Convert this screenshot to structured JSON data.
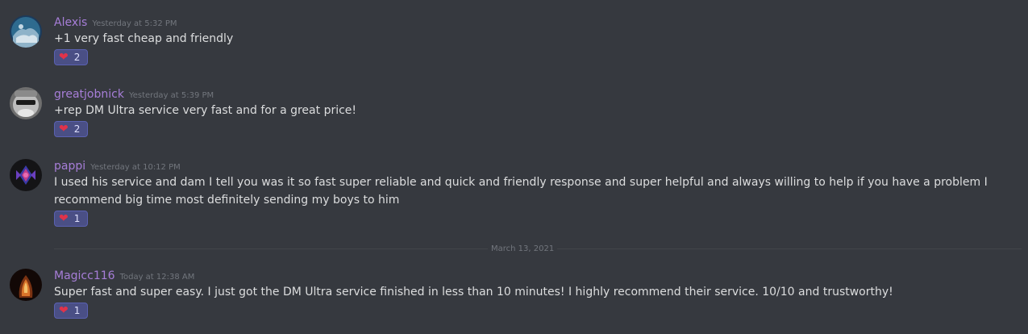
{
  "messages": [
    {
      "username": "Alexis",
      "timestamp": "Yesterday at 5:32 PM",
      "content": "+1 very fast cheap and friendly",
      "reaction": {
        "emoji": "heart-icon",
        "count": "2"
      }
    },
    {
      "username": "greatjobnick",
      "timestamp": "Yesterday at 5:39 PM",
      "content": "+rep DM Ultra service very fast and for a great price!",
      "reaction": {
        "emoji": "heart-icon",
        "count": "2"
      }
    },
    {
      "username": "pappi",
      "timestamp": "Yesterday at 10:12 PM",
      "content": "I used his service and dam I tell you was it so fast super reliable and quick and friendly response and super helpful and always willing to help if you have a problem I recommend big time most definitely sending my boys to him",
      "reaction": {
        "emoji": "heart-icon",
        "count": "1"
      }
    },
    {
      "username": "Magicc116",
      "timestamp": "Today at 12:38 AM",
      "content": "Super fast and super easy. I just got the DM Ultra service finished in less than 10 minutes!  I highly recommend their service. 10/10 and trustworthy!",
      "reaction": {
        "emoji": "heart-icon",
        "count": "1"
      }
    }
  ],
  "divider": {
    "date": "March 13, 2021"
  },
  "colors": {
    "background": "#36393f",
    "username": "#a77ed8",
    "text": "#dcddde",
    "timestamp": "#72767d",
    "reaction_bg": "#4a4f85",
    "heart": "#e0334a"
  }
}
